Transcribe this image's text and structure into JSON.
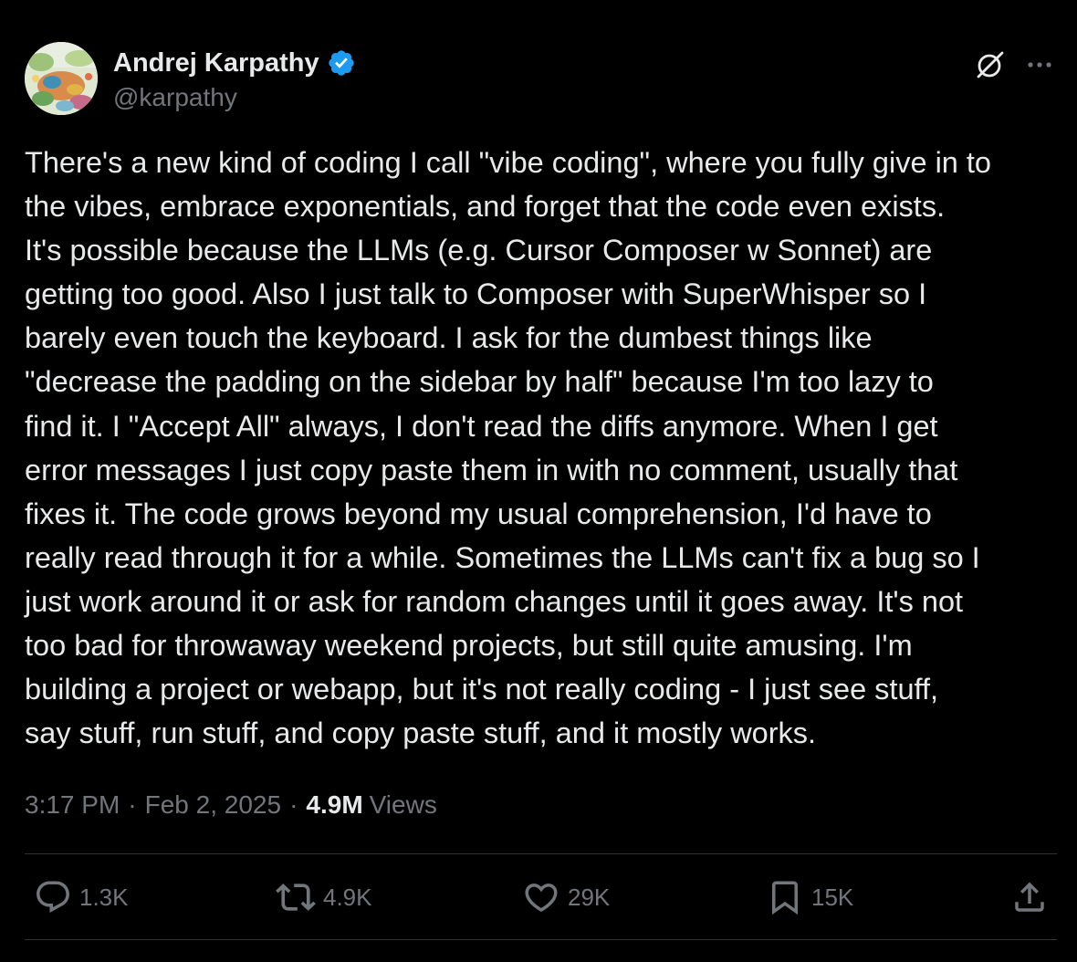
{
  "author": {
    "name": "Andrej Karpathy",
    "handle": "@karpathy",
    "verified_color": "#1d9bf0"
  },
  "tweet": {
    "text": "There's a new kind of coding I call \"vibe coding\", where you fully give in to\nthe vibes, embrace exponentials, and forget that the code even exists.\nIt's possible because the LLMs (e.g. Cursor Composer w Sonnet) are\ngetting too good. Also I just talk to Composer with SuperWhisper so I\nbarely even touch the keyboard. I ask for the dumbest things like\n\"decrease the padding on the sidebar by half\" because I'm too lazy to\nfind it. I \"Accept All\" always, I don't read the diffs anymore. When I get\nerror messages I just copy paste them in with no comment, usually that\nfixes it. The code grows beyond my usual comprehension, I'd have to\nreally read through it for a while. Sometimes the LLMs can't fix a bug so I\njust work around it or ask for random changes until it goes away. It's not\ntoo bad for throwaway weekend projects, but still quite amusing. I'm\nbuilding a project or webapp, but it's not really coding - I just see stuff,\nsay stuff, run stuff, and copy paste stuff, and it mostly works."
  },
  "meta": {
    "time": "3:17 PM",
    "separator": "·",
    "date": "Feb 2, 2025",
    "views_count": "4.9M",
    "views_label": "Views"
  },
  "actions": {
    "replies": "1.3K",
    "reposts": "4.9K",
    "likes": "29K",
    "bookmarks": "15K"
  },
  "icons": {
    "grok": "grok-icon",
    "more": "more-icon",
    "reply": "reply-icon",
    "repost": "repost-icon",
    "like": "like-icon",
    "bookmark": "bookmark-icon",
    "share": "share-icon"
  },
  "colors": {
    "background": "#000000",
    "text_primary": "#e7e9ea",
    "text_secondary": "#71767b",
    "divider": "#2f3336",
    "verified": "#1d9bf0"
  }
}
